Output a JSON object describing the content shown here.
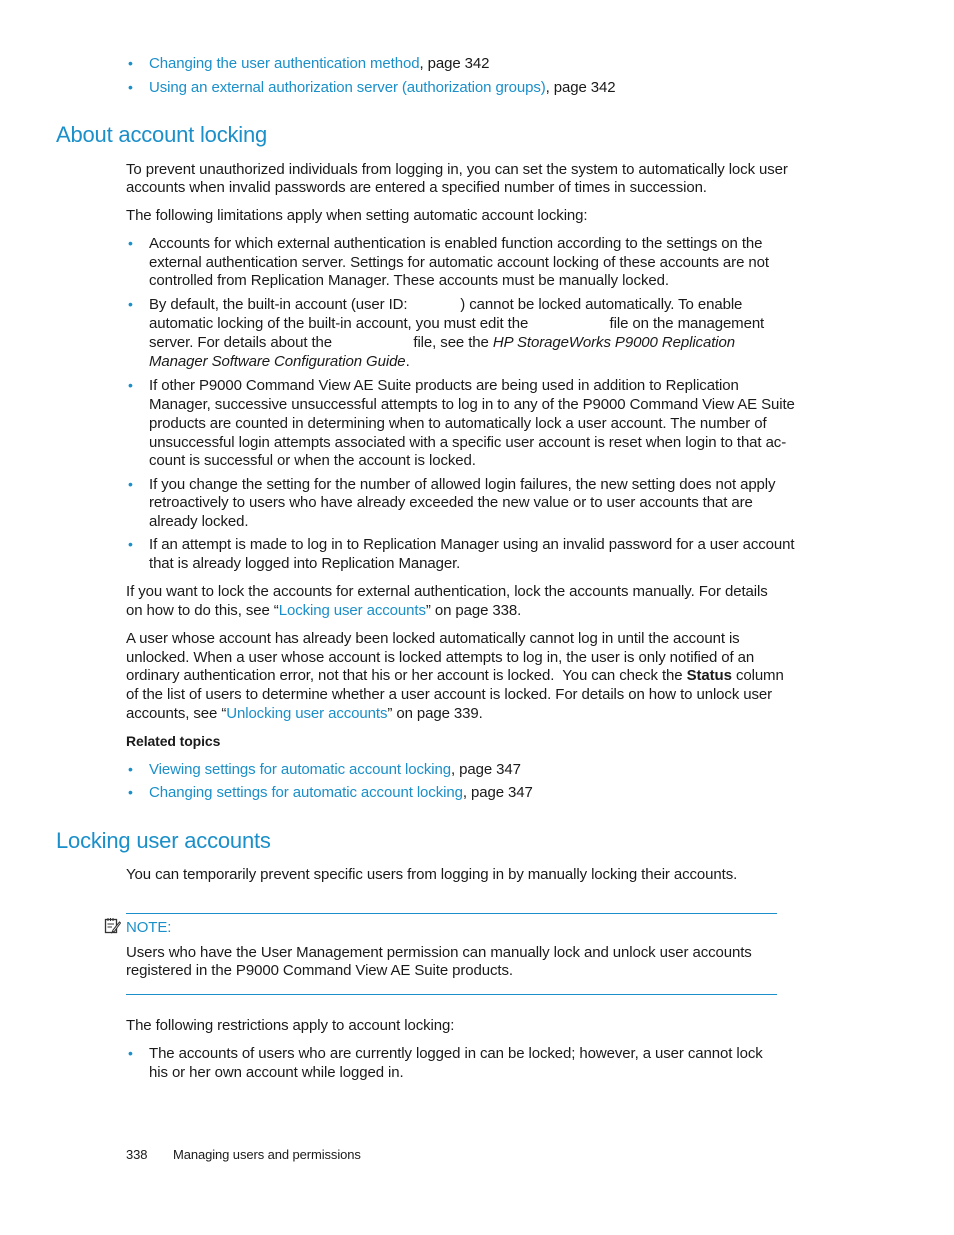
{
  "top_links": [
    {
      "link": "Changing the user authentication method",
      "suffix": ", page 342"
    },
    {
      "link": "Using an external authorization server (authorization groups)",
      "suffix": ", page 342"
    }
  ],
  "section1": {
    "heading": "About account locking",
    "intro": [
      "To prevent unauthorized individuals from logging in, you can set the system to automatically lock user",
      "accounts when invalid passwords are entered a specified number of times in succession."
    ],
    "limitations_intro": "The following limitations apply when setting automatic account locking:",
    "bullets": [
      [
        "Accounts for which external authentication is enabled function according to the settings on the",
        "external authentication server. Settings for automatic account locking of these accounts are not",
        "controlled from Replication Manager. These accounts must be manually locked."
      ],
      [
        "By default, the built-in account (user ID:             ) cannot be locked automatically. To enable",
        "automatic locking of the built-in account, you must edit the                    file on the management",
        "server. For details about the                    file, see the ",
        "Manager Software Configuration Guide"
      ],
      [
        "If other P9000 Command View AE Suite products are being used in addition to Replication",
        "Manager, successive unsuccessful attempts to log in to any of the P9000 Command View AE Suite",
        "products are counted in determining when to automatically lock a user account. The number of",
        "unsuccessful login attempts associated with a specific user account is reset when login to that ac-",
        "count is successful or when the account is locked."
      ],
      [
        "If you change the setting for the number of allowed login failures, the new setting does not apply",
        "retroactively to users who have already exceeded the new value or to user accounts that are",
        "already locked."
      ],
      [
        "If an attempt is made to log in to Replication Manager using an invalid password for a user account",
        "that is already logged into Replication Manager."
      ]
    ],
    "guide_title_part1": "HP StorageWorks P9000 Replication",
    "period": ".",
    "para_external": {
      "line1": "If you want to lock the accounts for external authentication, lock the accounts manually. For details",
      "line2_prefix": "on how to do this, see “",
      "line2_link": "Locking user accounts",
      "line2_suffix": "” on page 338."
    },
    "para_locked": {
      "lines": [
        "A user whose account has already been locked automatically cannot log in until the account is",
        "unlocked. When a user whose account is locked attempts to log in, the user is only notified of an"
      ],
      "line3_prefix": "ordinary authentication error, not that his or her account is locked.  You can check the ",
      "line3_bold": "Status",
      "line3_suffix": " column",
      "line4": "of the list of users to determine whether a user account is locked. For details on how to unlock user",
      "line5_prefix": "accounts, see “",
      "line5_link": "Unlocking user accounts",
      "line5_suffix": "” on page 339."
    },
    "related_heading": "Related topics",
    "related": [
      {
        "link": "Viewing settings for automatic account locking",
        "suffix": ", page 347"
      },
      {
        "link": "Changing settings for automatic account locking",
        "suffix": ", page 347"
      }
    ]
  },
  "section2": {
    "heading": "Locking user accounts",
    "intro": "You can temporarily prevent specific users from logging in by manually locking their accounts.",
    "note_label": "NOTE:",
    "note_lines": [
      "Users who have the User Management permission can manually lock and unlock user accounts",
      "registered in the P9000 Command View AE Suite products."
    ],
    "restrictions_intro": "The following restrictions apply to account locking:",
    "bullets": [
      [
        "The accounts of users who are currently logged in can be locked; however, a user cannot lock",
        "his or her own account while logged in."
      ]
    ]
  },
  "footer": {
    "page_number": "338",
    "chapter": "Managing users and permissions"
  },
  "bullet_char": "•",
  "colors": {
    "accent": "#1a8fc9",
    "text": "#1a1a1a"
  }
}
